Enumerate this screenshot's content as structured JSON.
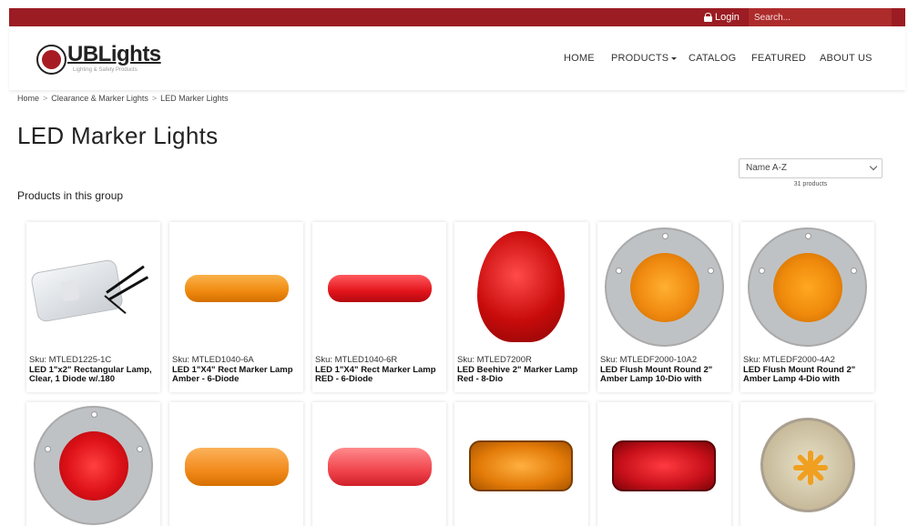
{
  "topbar": {
    "login_label": "Login",
    "search_placeholder": "Search..."
  },
  "brand": {
    "name": "UBLights",
    "tagline": "Lighting & Safety Products"
  },
  "nav": {
    "home": "HOME",
    "products": "PRODUCTS",
    "catalog": "CATALOG",
    "featured": "FEATURED",
    "about": "ABOUT US"
  },
  "breadcrumb": {
    "home": "Home",
    "sep": ">",
    "parent": "Clearance & Marker Lights",
    "current": "LED Marker Lights"
  },
  "page_title": "LED Marker Lights",
  "sort": {
    "selected": "Name A-Z",
    "count": "31 products"
  },
  "group_label": "Products in this group",
  "products": [
    {
      "sku": "Sku: MTLED1225-1C",
      "name": "LED 1\"x2\" Rectangular Lamp, Clear, 1 Diode w/.180"
    },
    {
      "sku": "Sku: MTLED1040-6A",
      "name": "LED 1\"X4\" Rect Marker Lamp Amber - 6-Diode"
    },
    {
      "sku": "Sku: MTLED1040-6R",
      "name": "LED 1\"X4\" Rect Marker Lamp RED - 6-Diode"
    },
    {
      "sku": "Sku: MTLED7200R",
      "name": "LED Beehive 2\" Marker Lamp Red - 8-Dio"
    },
    {
      "sku": "Sku: MTLEDF2000-10A2",
      "name": "LED Flush Mount Round 2\" Amber Lamp 10-Dio with"
    },
    {
      "sku": "Sku: MTLEDF2000-4A2",
      "name": "LED Flush Mount Round 2\" Amber Lamp 4-Dio with"
    }
  ],
  "colors": {
    "brand_red": "#9b1c22",
    "amber": "#f08a10",
    "red": "#d8151c"
  }
}
